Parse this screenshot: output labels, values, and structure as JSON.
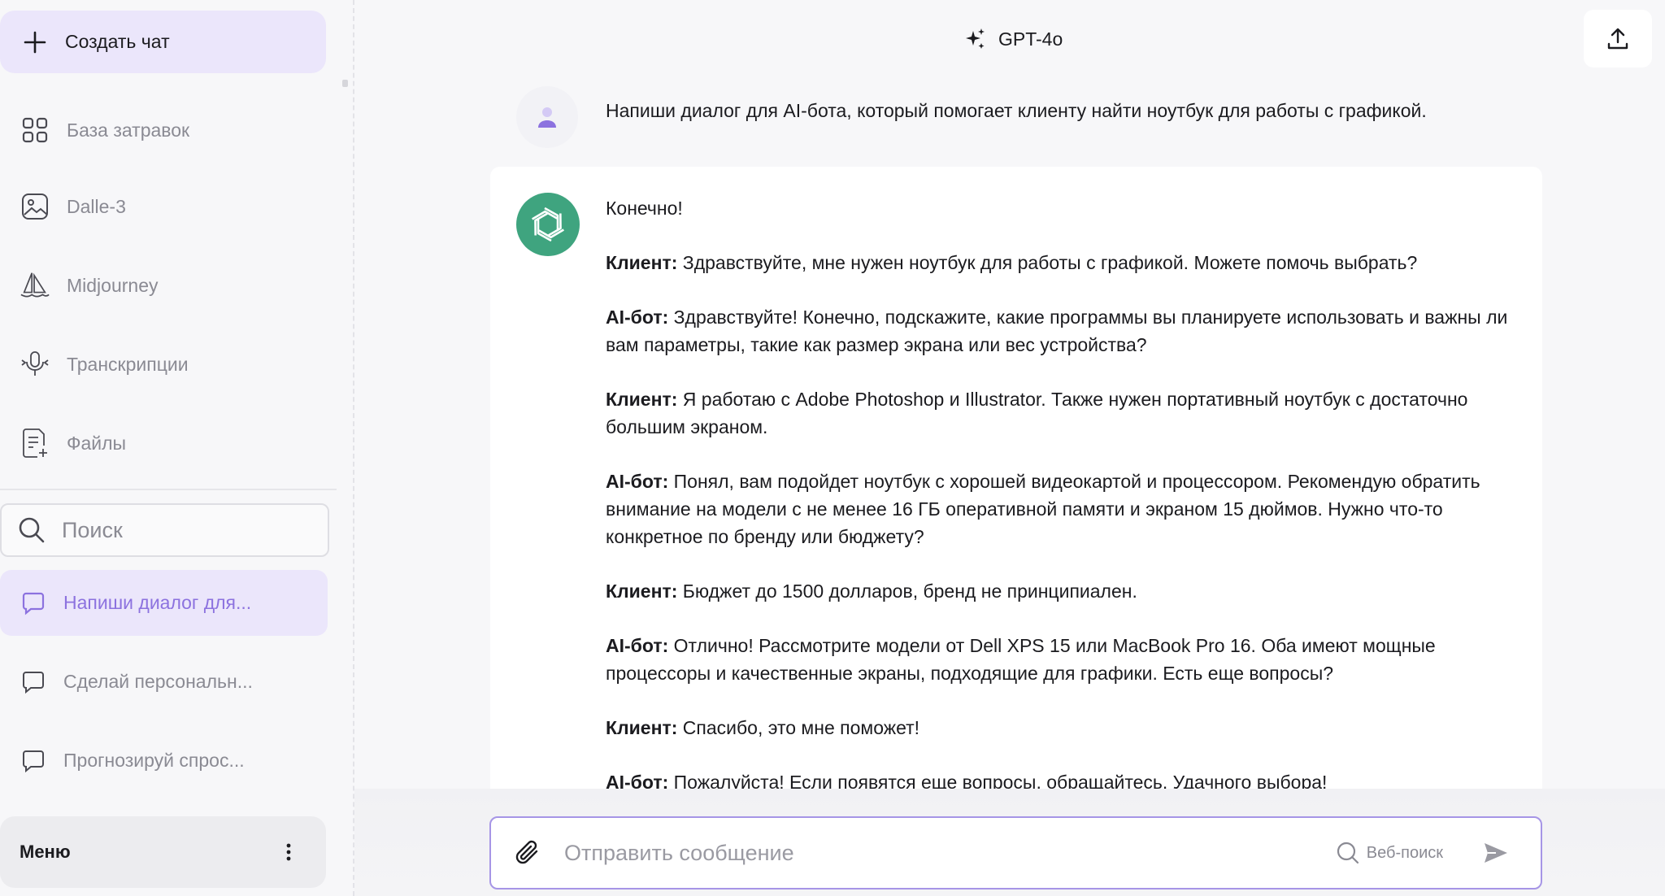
{
  "colors": {
    "accent": "#8c72df",
    "accent_bg": "#ebe6fb",
    "bot_avatar": "#3fa47f",
    "composer_border": "#a695e6"
  },
  "sidebar": {
    "new_chat_label": "Создать чат",
    "nav": [
      {
        "label": "База затравок",
        "icon": "grid-icon"
      },
      {
        "label": "Dalle-3",
        "icon": "image-icon"
      },
      {
        "label": "Midjourney",
        "icon": "sailboat-icon"
      },
      {
        "label": "Транскрипции",
        "icon": "microphone-icon"
      },
      {
        "label": "Файлы",
        "icon": "file-add-icon"
      }
    ],
    "search_placeholder": "Поиск",
    "chats": [
      {
        "label": "Напиши диалог для...",
        "active": true
      },
      {
        "label": "Сделай персональн...",
        "active": false
      },
      {
        "label": "Прогнозируй спрос...",
        "active": false
      }
    ],
    "menu_label": "Меню"
  },
  "header": {
    "model": "GPT-4o"
  },
  "conversation": {
    "user_message": "Напиши диалог для AI-бота, который помогает клиенту найти ноутбук для работы с графикой.",
    "bot_intro": "Конечно!",
    "bot_lines": [
      {
        "speaker": "Клиент:",
        "text": " Здравствуйте, мне нужен ноутбук для работы с графикой. Можете помочь выбрать?"
      },
      {
        "speaker": "AI-бот:",
        "text": " Здравствуйте! Конечно, подскажите, какие программы вы планируете использовать и важны ли вам параметры, такие как размер экрана или вес устройства?"
      },
      {
        "speaker": "Клиент:",
        "text": " Я работаю с Adobe Photoshop и Illustrator. Также нужен портативный ноутбук с достаточно большим экраном."
      },
      {
        "speaker": "AI-бот:",
        "text": " Понял, вам подойдет ноутбук с хорошей видеокартой и процессором. Рекомендую обратить внимание на модели с не менее 16 ГБ оперативной памяти и экраном 15 дюймов. Нужно что-то конкретное по бренду или бюджету?"
      },
      {
        "speaker": "Клиент:",
        "text": " Бюджет до 1500 долларов, бренд не принципиален."
      },
      {
        "speaker": "AI-бот:",
        "text": " Отлично! Рассмотрите модели от Dell XPS 15 или MacBook Pro 16. Оба имеют мощные процессоры и качественные экраны, подходящие для графики. Есть еще вопросы?"
      },
      {
        "speaker": "Клиент:",
        "text": " Спасибо, это мне поможет!"
      },
      {
        "speaker": "AI-бот:",
        "text": " Пожалуйста! Если появятся еще вопросы, обращайтесь. Удачного выбора!"
      }
    ]
  },
  "composer": {
    "placeholder": "Отправить сообщение",
    "web_search_label": "Веб-поиск"
  }
}
